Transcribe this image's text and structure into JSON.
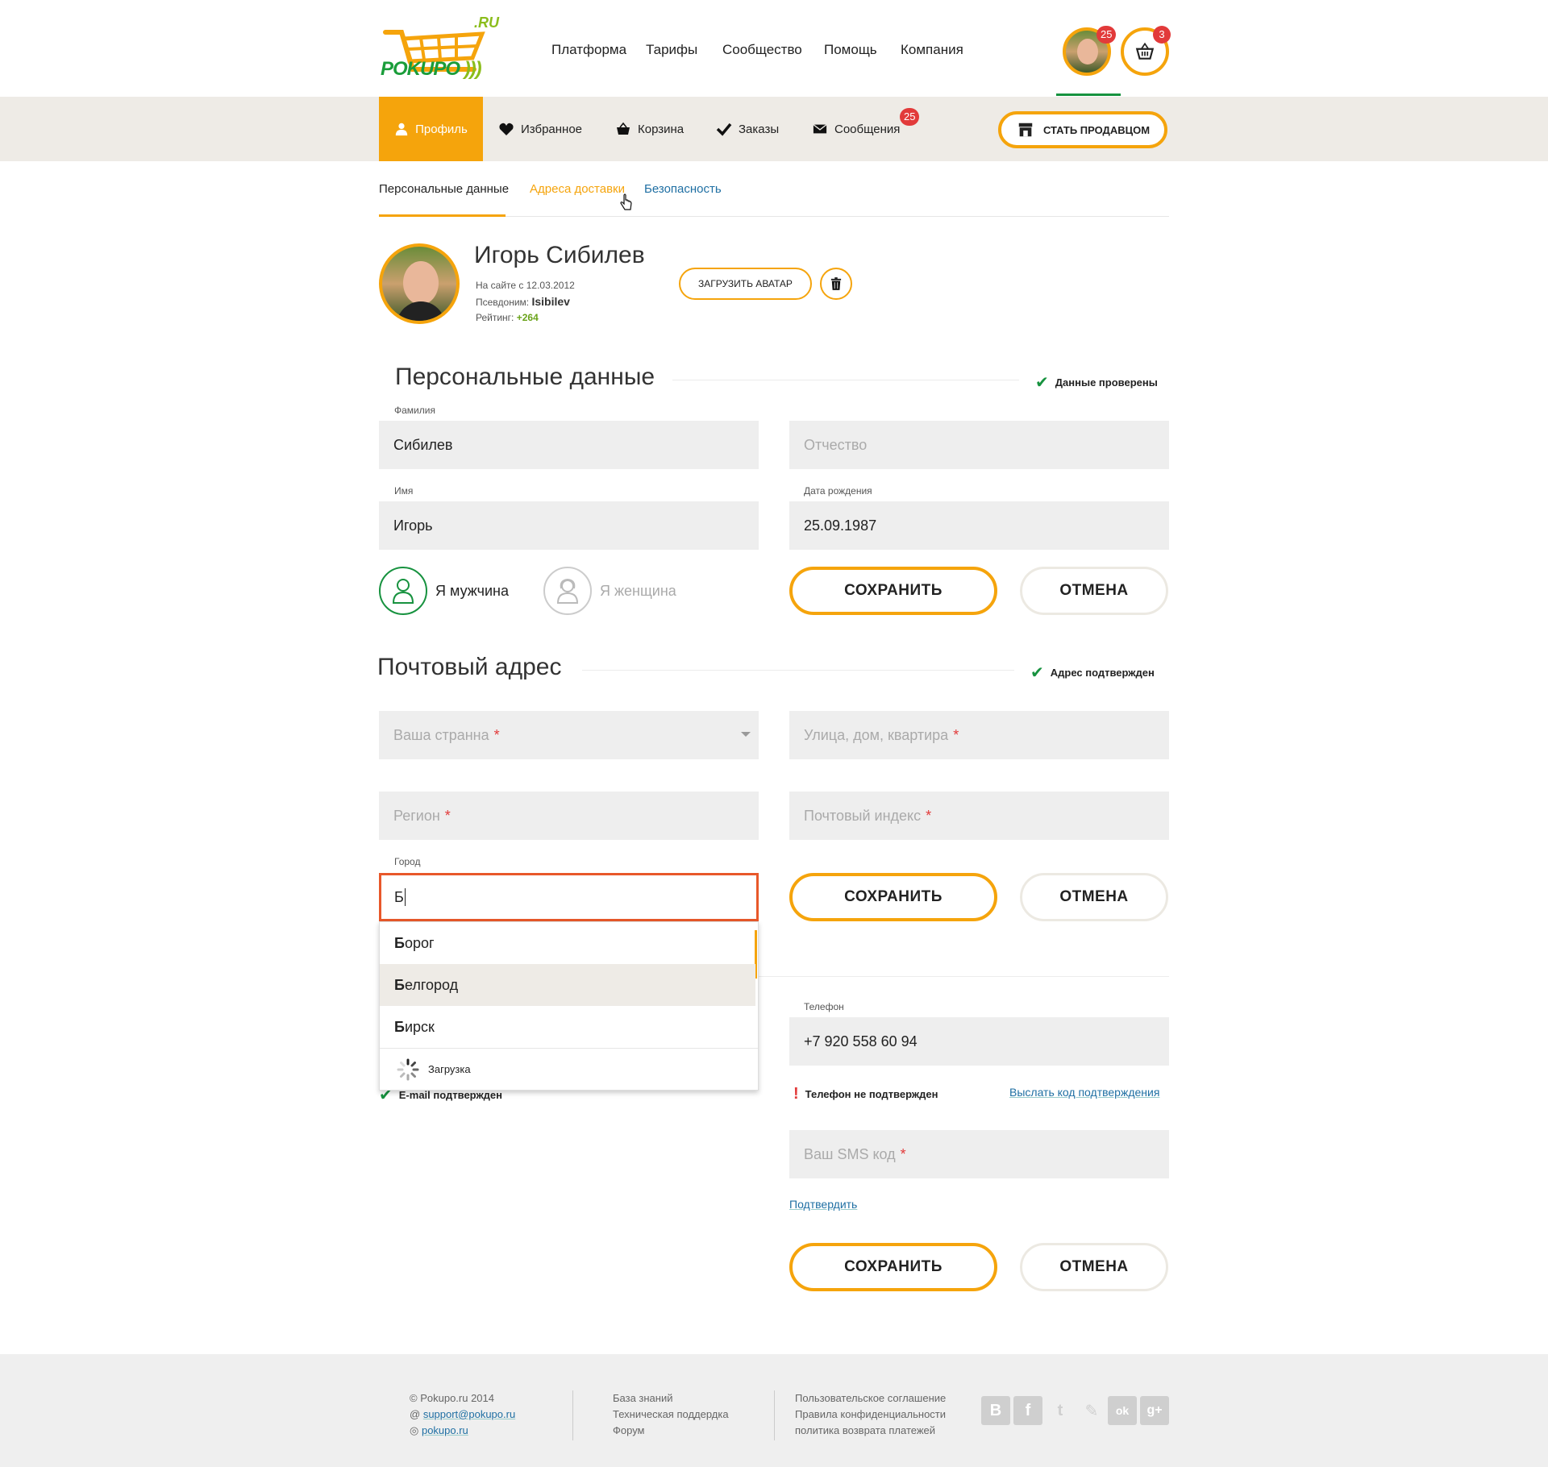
{
  "brand": {
    "name": "POKUPO",
    "suffix": ".RU"
  },
  "topnav": [
    "Платформа",
    "Тарифы",
    "Сообщество",
    "Помощь",
    "Компания"
  ],
  "header_badges": {
    "avatar_count": "25",
    "cart_count": "3"
  },
  "subnav": {
    "items": [
      {
        "label": "Профиль",
        "icon": "user-icon"
      },
      {
        "label": "Избранное",
        "icon": "heart-icon"
      },
      {
        "label": "Корзина",
        "icon": "basket-icon"
      },
      {
        "label": "Заказы",
        "icon": "check-icon"
      },
      {
        "label": "Сообщения",
        "icon": "envelope-icon"
      }
    ],
    "messages_badge": "25",
    "seller_button": "СТАТЬ ПРОДАВЦОМ"
  },
  "tabs": [
    "Персональные данные",
    "Адреса доставки",
    "Безопасность"
  ],
  "profile": {
    "name": "Игорь Сибилев",
    "since_label": "На сайте с 12.03.2012",
    "alias_label": "Псевдоним:",
    "alias": "Isibilev",
    "rating_label": "Рейтинг:",
    "rating": "+264",
    "upload_button": "ЗАГРУЗИТЬ АВАТАР"
  },
  "personal": {
    "title": "Персональные данные",
    "verified": "Данные проверены",
    "surname_label": "Фамилия",
    "surname": "Сибилев",
    "patronymic_placeholder": "Отчество",
    "name_label": "Имя",
    "name": "Игорь",
    "birth_label": "Дата рождения",
    "birth": "25.09.1987",
    "male": "Я мужчина",
    "female": "Я женщина",
    "save": "СОХРАНИТЬ",
    "cancel": "ОТМЕНА"
  },
  "address": {
    "title": "Почтовый адрес",
    "verified": "Адрес подтвержден",
    "country_placeholder": "Ваша странна",
    "street_placeholder": "Улица, дом, квартира",
    "region_placeholder": "Регион",
    "zip_placeholder": "Почтовый индекс",
    "city_label": "Город",
    "city_value": "Б",
    "suggestions": [
      {
        "bold": "Б",
        "rest": "орог"
      },
      {
        "bold": "Б",
        "rest": "елгород"
      },
      {
        "bold": "Б",
        "rest": "ирск"
      }
    ],
    "loading": "Загрузка",
    "save": "СОХРАНИТЬ",
    "cancel": "ОТМЕНА"
  },
  "contacts": {
    "email_verified": "E-mail подтвержден",
    "phone_label": "Телефон",
    "phone": "+7 920 558 60 94",
    "phone_status": "Телефон не подтвержден",
    "send_code": "Выслать код подтверждения",
    "sms_placeholder": "Ваш SMS код",
    "confirm": "Подтвердить",
    "save": "СОХРАНИТЬ",
    "cancel": "ОТМЕНА"
  },
  "footer": {
    "copyright": "Pokupo.ru 2014",
    "email": "support@pokupo.ru",
    "skype": "pokupo.ru",
    "col2": [
      "База знаний",
      "Техническая поддердка",
      "Форум"
    ],
    "col3": [
      "Пользовательское соглашение",
      "Правила конфиденциальности",
      "политика возврата платежей"
    ],
    "social": [
      "B",
      "f",
      "t",
      "✎",
      "ok",
      "g+"
    ]
  },
  "colors": {
    "accent": "#f5a40c",
    "green": "#17923f",
    "link": "#1f6fa3",
    "error": "#e23a3a"
  }
}
